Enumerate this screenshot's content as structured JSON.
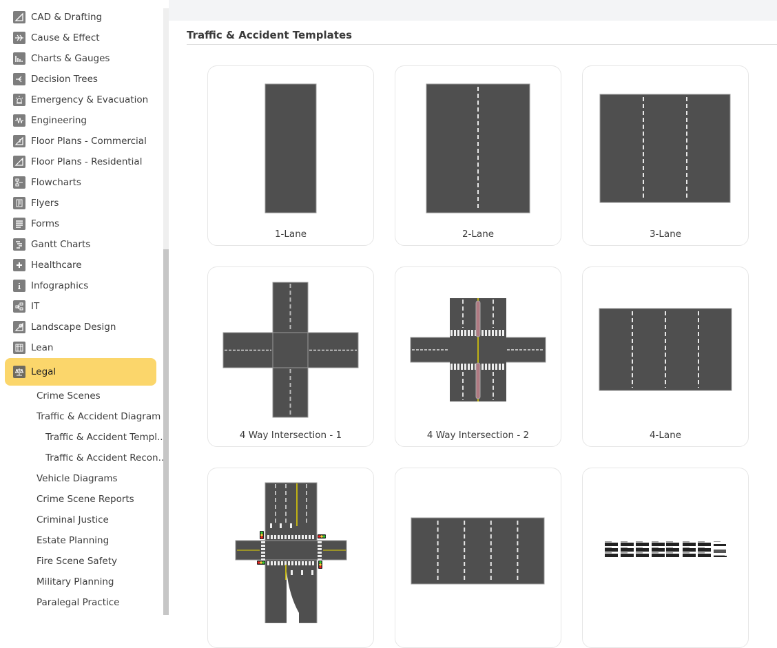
{
  "sidebar": {
    "categories": [
      {
        "label": "CAD & Drafting",
        "icon": "set-square-icon"
      },
      {
        "label": "Cause & Effect",
        "icon": "fishbone-icon"
      },
      {
        "label": "Charts & Gauges",
        "icon": "bar-chart-icon"
      },
      {
        "label": "Decision Trees",
        "icon": "decision-tree-icon"
      },
      {
        "label": "Emergency & Evacuation",
        "icon": "alarm-light-icon"
      },
      {
        "label": "Engineering",
        "icon": "waveform-icon"
      },
      {
        "label": "Floor Plans - Commercial",
        "icon": "floorplan-commercial-icon"
      },
      {
        "label": "Floor Plans - Residential",
        "icon": "floorplan-residential-icon"
      },
      {
        "label": "Flowcharts",
        "icon": "flowchart-icon"
      },
      {
        "label": "Flyers",
        "icon": "flyer-icon"
      },
      {
        "label": "Forms",
        "icon": "form-icon"
      },
      {
        "label": "Gantt Charts",
        "icon": "gantt-icon"
      },
      {
        "label": "Healthcare",
        "icon": "medical-cross-icon"
      },
      {
        "label": "Infographics",
        "icon": "info-icon"
      },
      {
        "label": "IT",
        "icon": "network-icon"
      },
      {
        "label": "Landscape Design",
        "icon": "landscape-icon"
      },
      {
        "label": "Lean",
        "icon": "grid-icon"
      }
    ],
    "active": {
      "label": "Legal",
      "icon": "scales-icon"
    },
    "subitems": [
      {
        "label": "Crime Scenes",
        "level": 1
      },
      {
        "label": "Traffic & Accident Diagram",
        "level": 1
      },
      {
        "label": "Traffic & Accident Templ...",
        "level": 2
      },
      {
        "label": "Traffic & Accident Recon...",
        "level": 2
      },
      {
        "label": "Vehicle Diagrams",
        "level": 1
      },
      {
        "label": "Crime Scene Reports",
        "level": 1
      },
      {
        "label": "Criminal Justice",
        "level": 1
      },
      {
        "label": "Estate Planning",
        "level": 1
      },
      {
        "label": "Fire Scene Safety",
        "level": 1
      },
      {
        "label": "Military Planning",
        "level": 1
      },
      {
        "label": "Paralegal Practice",
        "level": 1
      }
    ]
  },
  "main": {
    "section_title": "Traffic & Accident Templates",
    "templates": [
      {
        "label": "1-Lane",
        "thumb": "1-lane"
      },
      {
        "label": "2-Lane",
        "thumb": "2-lane"
      },
      {
        "label": "3-Lane",
        "thumb": "3-lane"
      },
      {
        "label": "4 Way Intersection - 1",
        "thumb": "4way-1"
      },
      {
        "label": "4 Way Intersection - 2",
        "thumb": "4way-2"
      },
      {
        "label": "4-Lane",
        "thumb": "4-lane"
      },
      {
        "label": "",
        "thumb": "signal-intersection"
      },
      {
        "label": "",
        "thumb": "5-lane"
      },
      {
        "label": "",
        "thumb": "report-form"
      }
    ]
  },
  "colors": {
    "active_highlight": "#fbd66b",
    "road": "#4f4f4f",
    "icon_bg": "#7d7d7d"
  }
}
